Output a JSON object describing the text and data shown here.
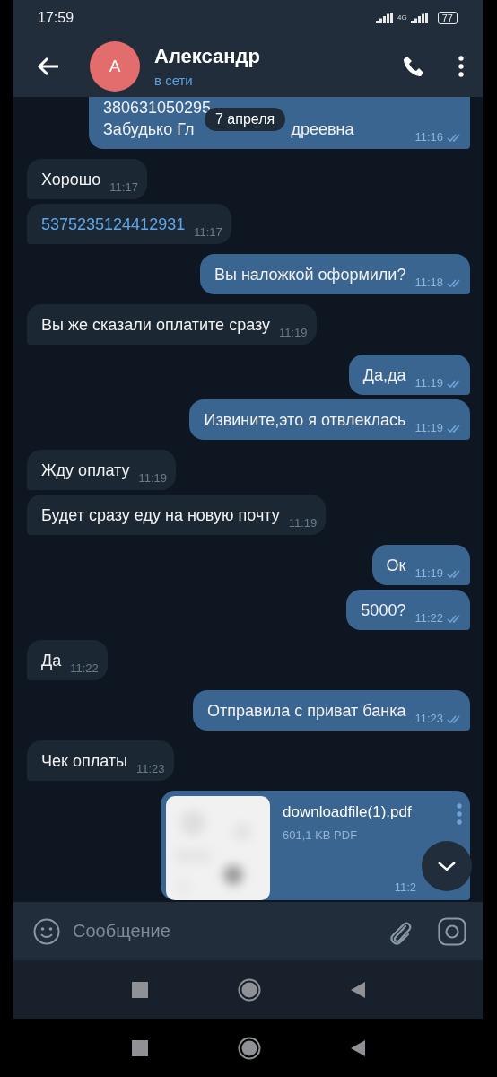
{
  "status_bar": {
    "time": "17:59",
    "network": "4G",
    "battery": "77"
  },
  "header": {
    "avatar_letter": "А",
    "name": "Александр",
    "status": "в сети"
  },
  "date_pill": "7 апреля",
  "messages": [
    {
      "kind": "cut",
      "outgoing": true,
      "lines": [
        "380631050295"
      ],
      "covered_line": [
        "Забудько Гл",
        "дреевна"
      ],
      "time": "11:16",
      "read": true
    },
    {
      "kind": "text",
      "outgoing": false,
      "text": "Хорошо",
      "time": "11:17"
    },
    {
      "kind": "link",
      "outgoing": false,
      "text": "5375235124412931",
      "time": "11:17"
    },
    {
      "kind": "text",
      "outgoing": true,
      "text": "Вы наложкой оформили?",
      "time": "11:18",
      "read": true
    },
    {
      "kind": "text",
      "outgoing": false,
      "text": "Вы же сказали оплатите сразу",
      "time": "11:19"
    },
    {
      "kind": "text",
      "outgoing": true,
      "text": "Да,да",
      "time": "11:19",
      "read": true
    },
    {
      "kind": "text",
      "outgoing": true,
      "text": "Извините,это я отвлеклась",
      "time": "11:19",
      "read": true
    },
    {
      "kind": "text",
      "outgoing": false,
      "text": "Жду оплату",
      "time": "11:19"
    },
    {
      "kind": "text",
      "outgoing": false,
      "text": "Будет сразу еду на новую почту",
      "time": "11:19"
    },
    {
      "kind": "text",
      "outgoing": true,
      "text": "Ок",
      "time": "11:19",
      "read": true
    },
    {
      "kind": "text",
      "outgoing": true,
      "text": "5000?",
      "time": "11:22",
      "read": true
    },
    {
      "kind": "text",
      "outgoing": false,
      "text": "Да",
      "time": "11:22"
    },
    {
      "kind": "text",
      "outgoing": true,
      "text": "Отправила с приват банка",
      "time": "11:23",
      "read": true
    },
    {
      "kind": "text",
      "outgoing": false,
      "text": "Чек оплаты",
      "time": "11:23"
    },
    {
      "kind": "file",
      "outgoing": true,
      "file_name": "downloadfile(1).pdf",
      "file_info": "601,1 KB PDF",
      "time": "11:2"
    }
  ],
  "composer": {
    "placeholder": "Сообщение"
  }
}
